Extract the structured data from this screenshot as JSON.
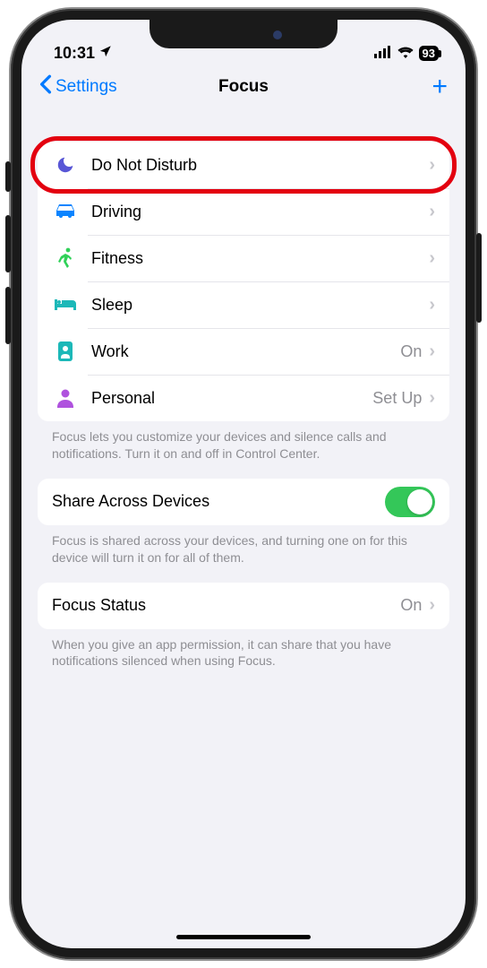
{
  "status": {
    "time": "10:31",
    "battery": "93"
  },
  "nav": {
    "back": "Settings",
    "title": "Focus"
  },
  "focus_modes": [
    {
      "label": "Do Not Disturb",
      "value": "",
      "icon": "moon",
      "color": "c-purple"
    },
    {
      "label": "Driving",
      "value": "",
      "icon": "car",
      "color": "c-blue"
    },
    {
      "label": "Fitness",
      "value": "",
      "icon": "running",
      "color": "c-green"
    },
    {
      "label": "Sleep",
      "value": "",
      "icon": "bed",
      "color": "c-teal"
    },
    {
      "label": "Work",
      "value": "On",
      "icon": "badge",
      "color": "c-teal"
    },
    {
      "label": "Personal",
      "value": "Set Up",
      "icon": "person",
      "color": "c-violet"
    }
  ],
  "footers": {
    "modes": "Focus lets you customize your devices and silence calls and notifications. Turn it on and off in Control Center.",
    "share": "Focus is shared across your devices, and turning one on for this device will turn it on for all of them.",
    "status": "When you give an app permission, it can share that you have notifications silenced when using Focus."
  },
  "share": {
    "label": "Share Across Devices"
  },
  "focus_status": {
    "label": "Focus Status",
    "value": "On"
  }
}
